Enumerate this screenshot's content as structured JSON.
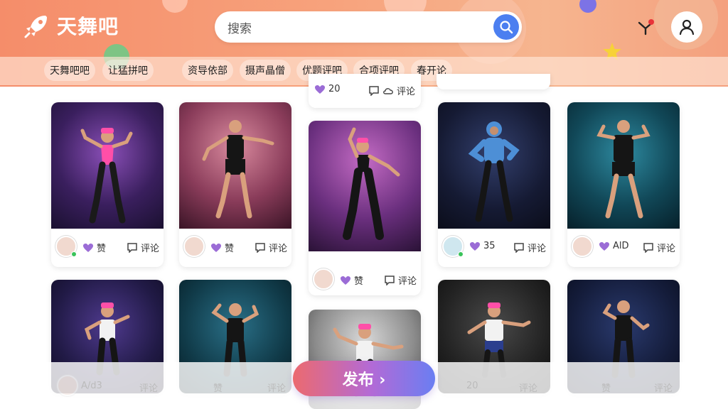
{
  "app": {
    "name": "天舞吧"
  },
  "search": {
    "text": "搜索"
  },
  "tabs": [
    "天舞吧吧",
    "让猛拼吧",
    "资导依部",
    "摄声晶僧",
    "优题评吧",
    "合项评吧",
    "春开论"
  ],
  "top_partial_card": {
    "likes": "20",
    "comment_label": "评论"
  },
  "cards": [
    {
      "like": "赞",
      "comment": "评论"
    },
    {
      "like": "赞",
      "comment": "评论"
    },
    {
      "like": "赞",
      "comment": "评论"
    },
    {
      "like": "35",
      "comment": "评论"
    },
    {
      "like": "AlD",
      "comment": "评论"
    }
  ],
  "bottom_ghost": {
    "a": "A/d3",
    "b": "评论",
    "c": "赞",
    "d": "评论",
    "e": "20",
    "f": "评论",
    "g": "赞",
    "h": "评论"
  },
  "publish": {
    "label": "发布 ›"
  },
  "colors": {
    "header": "#f58d6a",
    "accent": "#4c7ff0",
    "like_purple": "#9b6cd6"
  }
}
